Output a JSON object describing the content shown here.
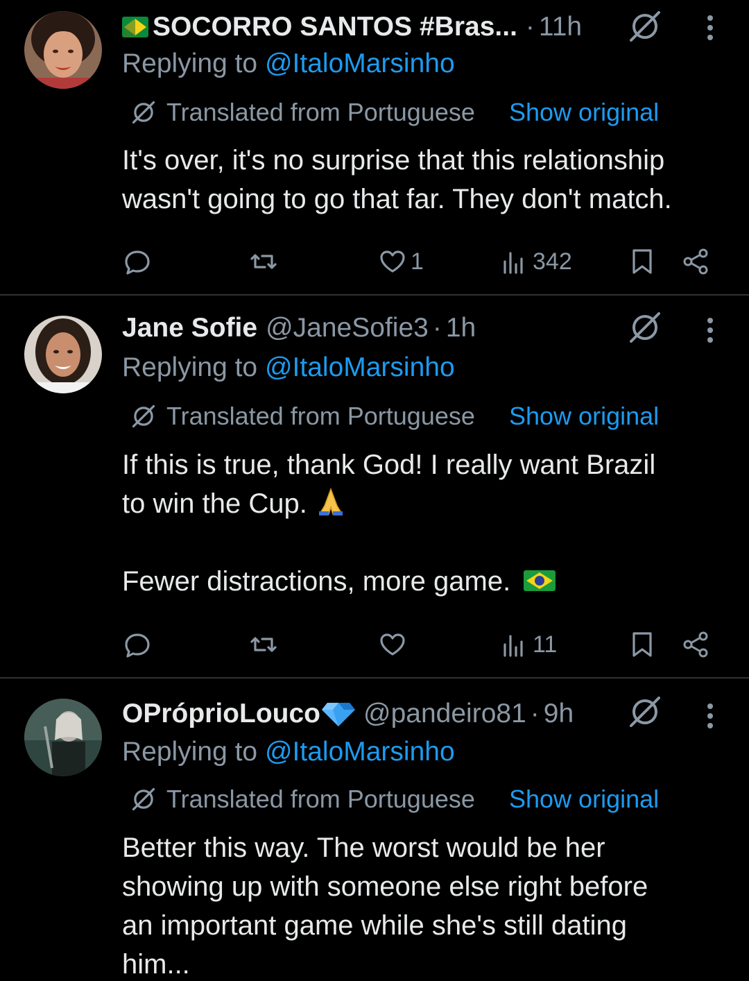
{
  "tweets": [
    {
      "name": "SOCORRO SANTOS #Bras...",
      "handle": "",
      "dot": "·",
      "time": "11h",
      "replying_prefix": "Replying to ",
      "replying_to": "@ItaloMarsinho",
      "translated_label": "Translated from Portuguese",
      "show_original": "Show original",
      "body": [
        "It's over, it's no surprise that this relationship",
        "wasn't going to go that far. They don't match."
      ],
      "likes": "1",
      "views": "342"
    },
    {
      "name": "Jane Sofie",
      "handle": "@JaneSofie3",
      "dot": "·",
      "time": "1h",
      "replying_prefix": "Replying to ",
      "replying_to": "@ItaloMarsinho",
      "translated_label": "Translated from Portuguese",
      "show_original": "Show original",
      "body": [
        "If this is true, thank God! I really want Brazil",
        "to win the Cup.",
        "Fewer distractions, more game."
      ],
      "likes": "",
      "views": "11"
    },
    {
      "name": "OPróprioLouco",
      "handle": "@pandeiro81",
      "dot": "·",
      "time": "9h",
      "replying_prefix": "Replying to ",
      "replying_to": "@ItaloMarsinho",
      "translated_label": "Translated from Portuguese",
      "show_original": "Show original",
      "body": [
        "Better this way. The worst would be her",
        "showing up with someone else right before",
        "an important game while she's still dating",
        "him..."
      ]
    }
  ],
  "icons": {
    "reply": "reply-icon",
    "retweet": "retweet-icon",
    "like": "heart-icon",
    "views": "views-icon",
    "bookmark": "bookmark-icon",
    "share": "share-icon",
    "grok": "grok-icon",
    "more": "more-icon"
  },
  "colors": {
    "background": "#000000",
    "text": "#e7e9ea",
    "muted": "#8b98a5",
    "link": "#1d9bf0",
    "divider": "#2f3336"
  }
}
